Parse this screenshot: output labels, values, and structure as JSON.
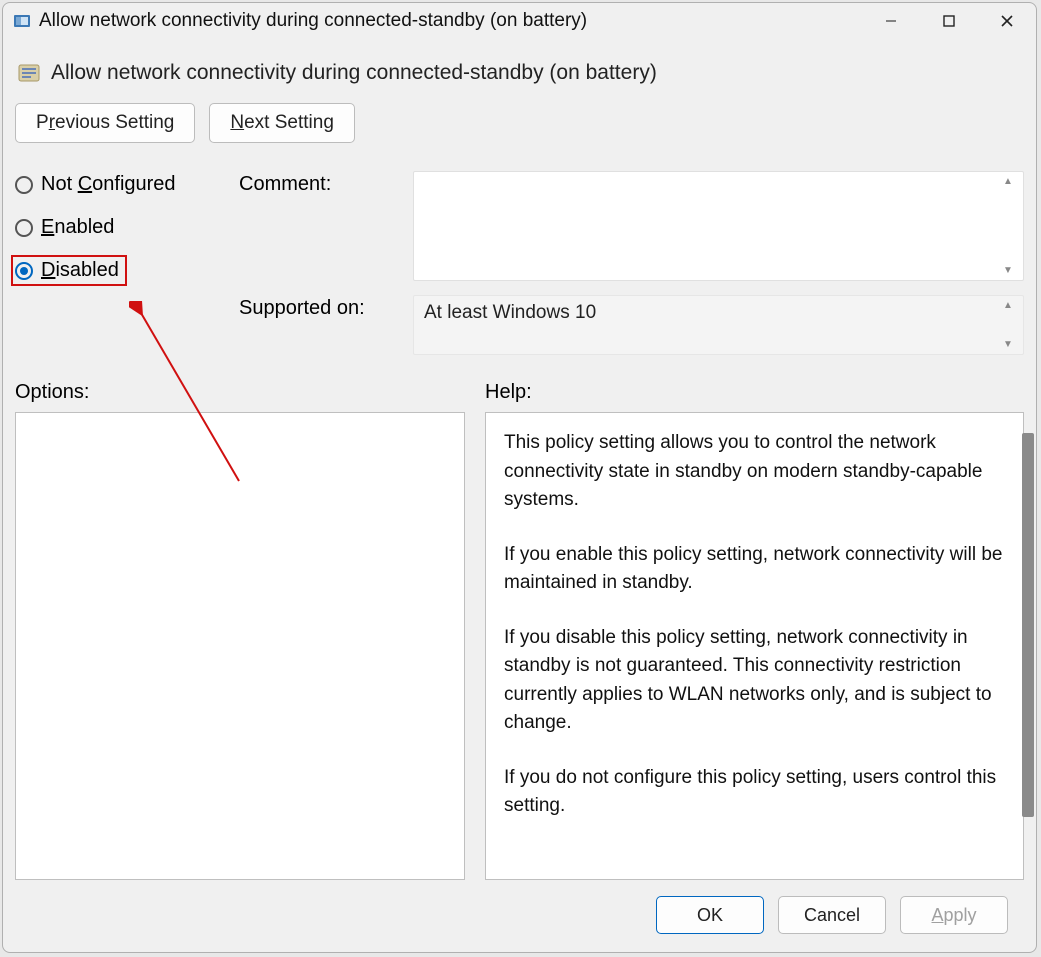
{
  "window": {
    "title": "Allow network connectivity during connected-standby (on battery)"
  },
  "header": {
    "title": "Allow network connectivity during connected-standby (on battery)"
  },
  "nav": {
    "previous": {
      "pre": "P",
      "underline": "r",
      "post": "evious Setting"
    },
    "next": {
      "pre": "",
      "underline": "N",
      "post": "ext Setting"
    }
  },
  "radios": {
    "not_configured": {
      "pre": "Not ",
      "underline": "C",
      "post": "onfigured"
    },
    "enabled": {
      "pre": "",
      "underline": "E",
      "post": "nabled"
    },
    "disabled": {
      "pre": "",
      "underline": "D",
      "post": "isabled"
    },
    "selected": "disabled"
  },
  "fields": {
    "comment_label": "Comment:",
    "comment_value": "",
    "supported_label": "Supported on:",
    "supported_value": "At least Windows 10"
  },
  "panels": {
    "options_label": "Options:",
    "help_label": "Help:"
  },
  "help": {
    "p1": "This policy setting allows you to control the network connectivity state in standby on modern standby-capable systems.",
    "p2": "If you enable this policy setting, network connectivity will be maintained in standby.",
    "p3": "If you disable this policy setting, network connectivity in standby is not guaranteed. This connectivity restriction currently applies to WLAN networks only, and is subject to change.",
    "p4": "If you do not configure this policy setting, users control this setting."
  },
  "footer": {
    "ok": "OK",
    "cancel": "Cancel",
    "apply": {
      "pre": "",
      "underline": "A",
      "post": "pply"
    }
  },
  "annotation": {
    "color": "#d01010"
  }
}
